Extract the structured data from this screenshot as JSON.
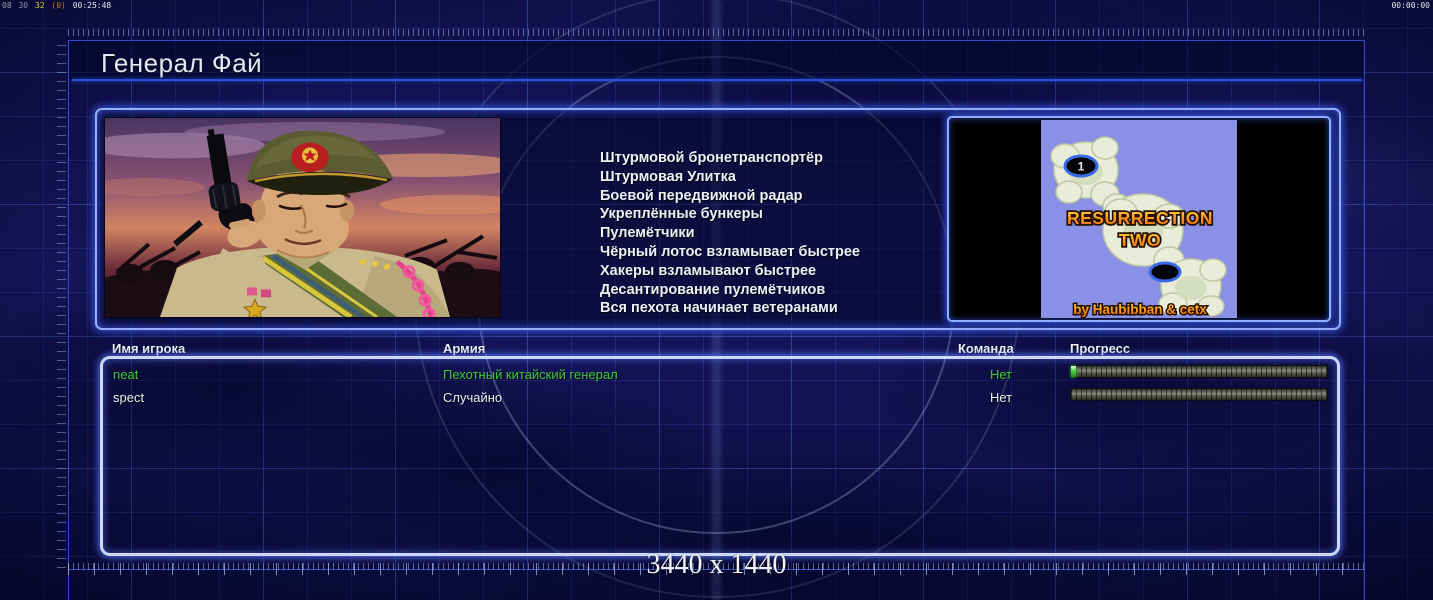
{
  "status_bar": {
    "debug_tokens": {
      "t1": "08",
      "t2": "30",
      "t3": "32",
      "t4": "(0)",
      "time": "00:25:48"
    },
    "timer_right": "00:00:00"
  },
  "header": {
    "title": "Генерал Фай"
  },
  "general_info": {
    "features": [
      "Штурмовой бронетранспортёр",
      "Штурмовая Улитка",
      "Боевой передвижной радар",
      "Укреплённые бункеры",
      "Пулемётчики",
      "Чёрный лотос взламывает быстрее",
      "Хакеры взламывают быстрее",
      "Десантирование пулемётчиков",
      "Вся пехота начинает ветеранами"
    ]
  },
  "map_preview": {
    "title_line1": "RESURRECTION",
    "title_line2": "TWO",
    "credit": "by Haubibban & cetx",
    "start_marker_label": "1"
  },
  "players_table": {
    "columns": {
      "name": "Имя игрока",
      "army": "Армия",
      "team": "Команда",
      "progress": "Прогресс"
    },
    "rows": [
      {
        "name": "neat",
        "army": "Пехотный китайский генерал",
        "team": "Нет",
        "progress_percent": 2,
        "color": "#3ecc3e"
      },
      {
        "name": "spect",
        "army": "Случайно",
        "team": "Нет",
        "progress_percent": 0,
        "color": "#eceef4"
      }
    ]
  },
  "footer": {
    "resolution": "3440 x 1440"
  },
  "colors": {
    "accent_glow": "#3c5cf0",
    "ready_green": "#3ecc3e",
    "map_title_orange": "#ff9a20",
    "panel_border": "#96b0f8"
  }
}
